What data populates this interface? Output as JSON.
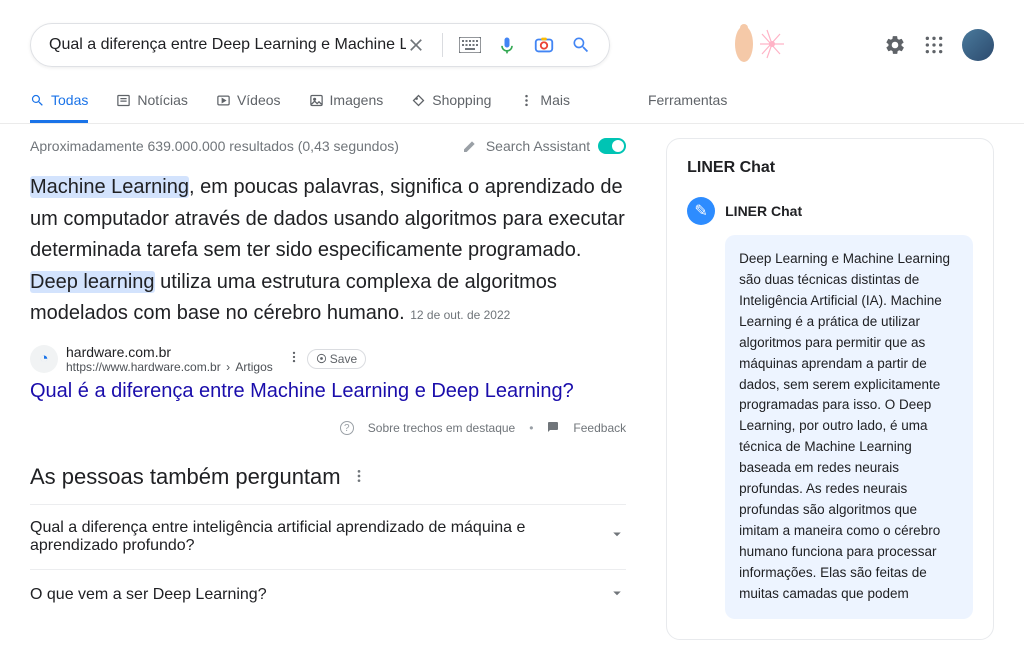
{
  "search": {
    "query": "Qual a diferença entre Deep Learning e Machine Learning?"
  },
  "tabs": {
    "all": "Todas",
    "news": "Notícias",
    "videos": "Vídeos",
    "images": "Imagens",
    "shopping": "Shopping",
    "more": "Mais",
    "tools": "Ferramentas"
  },
  "stats": "Aproximadamente 639.000.000 resultados (0,43 segundos)",
  "assist": {
    "label": "Search Assistant"
  },
  "snippet": {
    "hl1": "Machine Learning",
    "t1": ", em poucas palavras, significa o aprendizado de um computador através de dados usando algoritmos para executar determinada tarefa sem ter sido especificamente programado. ",
    "hl2": "Deep learning",
    "t2": " utiliza uma estrutura complexa de algoritmos modelados com base no cérebro humano.",
    "date": "12 de out. de 2022"
  },
  "source": {
    "site": "hardware.com.br",
    "url_base": "https://www.hardware.com.br",
    "url_crumb": "Artigos",
    "save": "Save",
    "title": "Qual é a diferença entre Machine Learning e Deep Learning?"
  },
  "footer": {
    "about": "Sobre trechos em destaque",
    "feedback": "Feedback"
  },
  "paa": {
    "title": "As pessoas também perguntam",
    "q1": "Qual a diferença entre inteligência artificial aprendizado de máquina e aprendizado profundo?",
    "q2": "O que vem a ser Deep Learning?"
  },
  "liner": {
    "panel_title": "LINER Chat",
    "bot_name": "LINER Chat",
    "message": "Deep Learning e Machine Learning são duas técnicas distintas de Inteligência Artificial (IA). Machine Learning é a prática de utilizar algoritmos para permitir que as máquinas aprendam a partir de dados, sem serem explicitamente programadas para isso. O Deep Learning, por outro lado, é uma técnica de Machine Learning baseada em redes neurais profundas. As redes neurais profundas são algoritmos que imitam a maneira como o cérebro humano funciona para processar informações. Elas são feitas de muitas camadas que podem"
  }
}
